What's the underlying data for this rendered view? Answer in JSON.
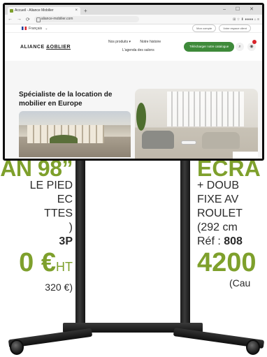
{
  "browser": {
    "tab_title": "Accueil - Aliance Mobilier",
    "new_tab": "+",
    "window_controls": "– ☐ ✕",
    "nav_back": "←",
    "nav_forward": "→",
    "nav_reload": "⟳",
    "url": "aliance-mobilier.com",
    "tools": "⊞ ☆   ⬇ ●●●● ⌂ ≡"
  },
  "site": {
    "language": "Français",
    "lang_chevron": "⌄",
    "pill_client": "Mon compte",
    "pill_devis": "Votre espace client",
    "logo_prefix": "ALIANCE",
    "logo_mid": "&",
    "logo_suffix": "OBLIER",
    "nav_products": "Nos produits ▾",
    "nav_history": "Notre histoire",
    "nav_agenda": "L'agenda des salons",
    "cta_label": "Télécharger notre catalogue",
    "search_icon": "⌕",
    "user_icon": "◉",
    "hero_title": "Spécialiste de la location de mobilier en Europe"
  },
  "product_left": {
    "title": "AN 98”",
    "line1": "LE PIED",
    "line2": "EC",
    "line3": "TTES",
    "line4": ")",
    "ref": "3P",
    "price": "0 €",
    "price_suffix": "HT",
    "ttc": "320 €)"
  },
  "product_right": {
    "title": "ÉCRA",
    "line1": "+ DOUB",
    "line2": "FIXE AV",
    "line3": "ROULET",
    "line4": "(292 cm",
    "ref_label": "Réf :",
    "ref_value": "808",
    "price": "4200",
    "ttc": "(Cau"
  }
}
